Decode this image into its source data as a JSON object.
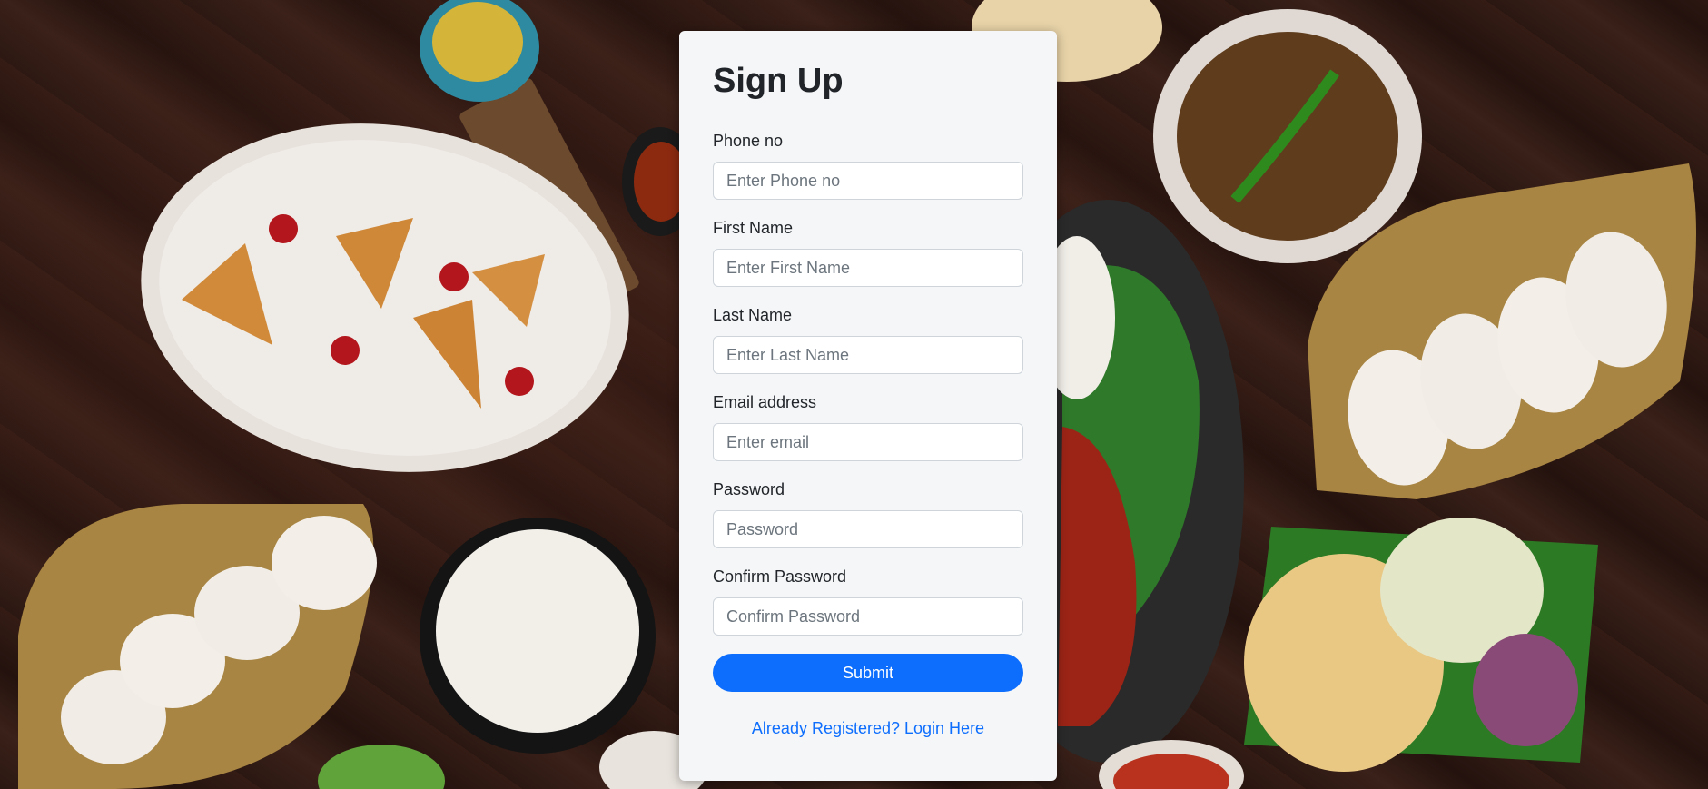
{
  "form": {
    "title": "Sign Up",
    "fields": [
      {
        "label": "Phone no",
        "placeholder": "Enter Phone no",
        "value": ""
      },
      {
        "label": "First Name",
        "placeholder": "Enter First Name",
        "value": ""
      },
      {
        "label": "Last Name",
        "placeholder": "Enter Last Name",
        "value": ""
      },
      {
        "label": "Email address",
        "placeholder": "Enter email",
        "value": ""
      },
      {
        "label": "Password",
        "placeholder": "Password",
        "value": ""
      },
      {
        "label": "Confirm Password",
        "placeholder": "Confirm Password",
        "value": ""
      }
    ],
    "submit_label": "Submit",
    "login_link": "Already Registered? Login Here"
  },
  "colors": {
    "primary": "#0d6efd",
    "card_background": "#f5f6f8",
    "page_background": "#2a1611"
  }
}
